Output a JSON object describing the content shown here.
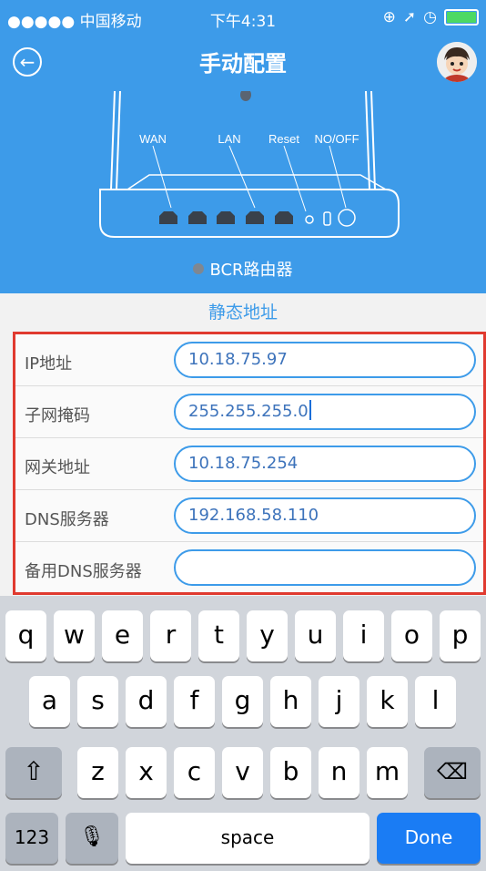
{
  "status_bar": {
    "carrier": "●●●●● 中国移动",
    "time": "下午4:31"
  },
  "nav": {
    "title": "手动配置"
  },
  "router": {
    "port_labels": [
      "WAN",
      "LAN",
      "Reset",
      "NO/OFF"
    ],
    "name": "BCR路由器"
  },
  "section_title": "静态地址",
  "form": {
    "fields": [
      {
        "label": "IP地址",
        "value": "10.18.75.97"
      },
      {
        "label": "子网掩码",
        "value": "255.255.255.0"
      },
      {
        "label": "网关地址",
        "value": "10.18.75.254"
      },
      {
        "label": "DNS服务器",
        "value": "192.168.58.110"
      },
      {
        "label": "备用DNS服务器",
        "value": ""
      }
    ]
  },
  "keyboard": {
    "row1": [
      "q",
      "w",
      "e",
      "r",
      "t",
      "y",
      "u",
      "i",
      "o",
      "p"
    ],
    "row2": [
      "a",
      "s",
      "d",
      "f",
      "g",
      "h",
      "j",
      "k",
      "l"
    ],
    "row3": [
      "z",
      "x",
      "c",
      "v",
      "b",
      "n",
      "m"
    ],
    "shift_icon": "⇧",
    "backspace_icon": "⌫",
    "mic_icon": "🎙",
    "numbers_label": "123",
    "space_label": "space",
    "done_label": "Done"
  },
  "colors": {
    "header_blue": "#3d9be9",
    "highlight_red": "#e03a2f",
    "done_blue": "#1a7cf4"
  }
}
